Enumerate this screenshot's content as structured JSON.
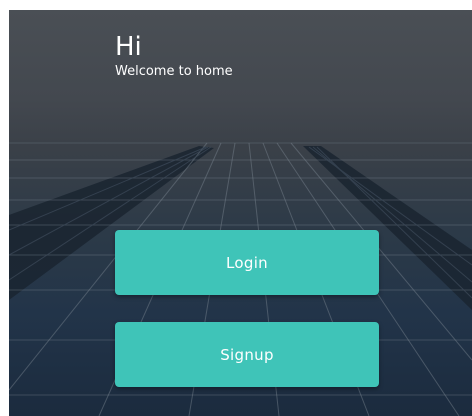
{
  "screen": {
    "title": "Hi",
    "subtitle": "Welcome to home"
  },
  "buttons": {
    "login": "Login",
    "signup": "Signup"
  },
  "colors": {
    "button": "#3fc4b8",
    "text": "#ffffff",
    "background_top": "#4a4f55",
    "background_bottom": "#1b2b3e"
  }
}
